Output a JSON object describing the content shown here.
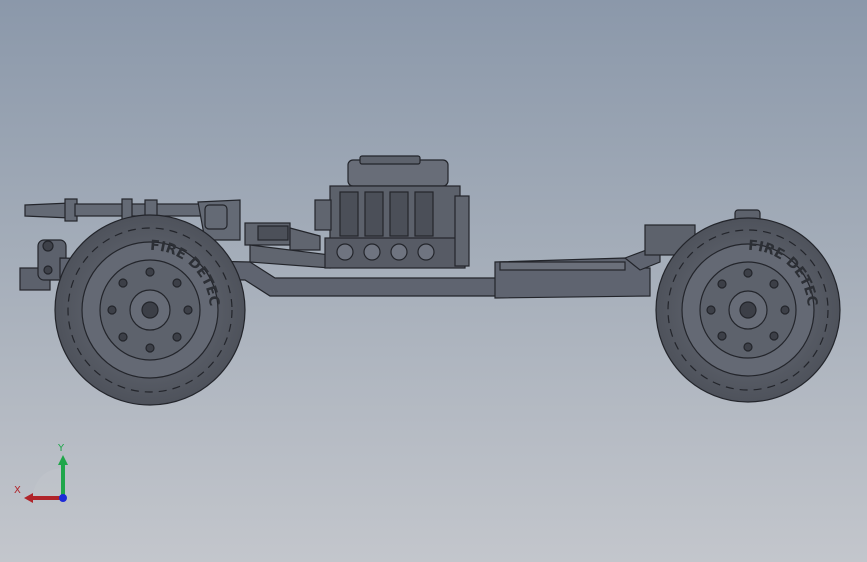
{
  "viewport": {
    "background_top": "#8b98aa",
    "background_bottom": "#c3c6cc",
    "model_color": "#5f6470",
    "edge_color": "#23252b"
  },
  "model": {
    "name": "vehicle-chassis",
    "tire_text": "FIRE DETECT"
  },
  "triad": {
    "y_label": "Y",
    "x_label": "X",
    "y_color": "#1fa64a",
    "x_color": "#b0242a",
    "z_color": "#1d2ad8"
  }
}
